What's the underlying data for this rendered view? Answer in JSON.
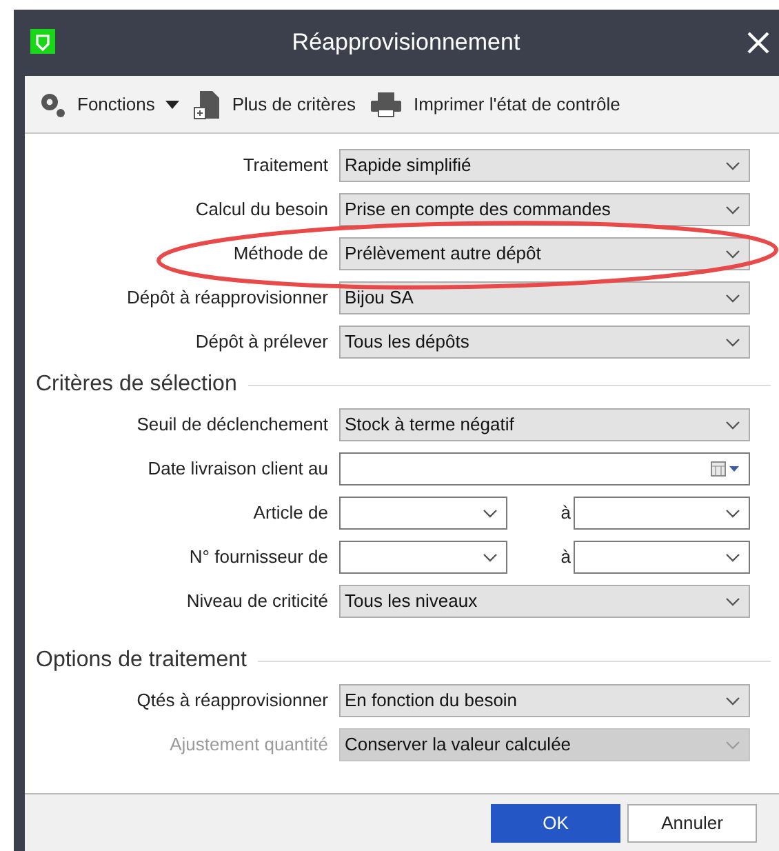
{
  "window": {
    "title": "Réapprovisionnement"
  },
  "toolbar": [
    {
      "label": "Fonctions",
      "kind": "menu"
    },
    {
      "label": "Plus de critères",
      "kind": "doc"
    },
    {
      "label": "Imprimer l'état de contrôle",
      "kind": "print"
    }
  ],
  "sections": [
    {
      "rows": [
        {
          "kind": "select",
          "label": "Traitement",
          "value": "Rapide simplifié",
          "disabled": false
        },
        {
          "kind": "select",
          "label": "Calcul du besoin",
          "value": "Prise en compte des commandes",
          "disabled": false
        },
        {
          "kind": "select",
          "label": "Méthode de",
          "value": "Prélèvement autre dépôt",
          "disabled": false
        },
        {
          "kind": "select",
          "label": "Dépôt à réapprovisionner",
          "value": "Bijou SA",
          "disabled": false
        },
        {
          "kind": "select",
          "label": "Dépôt à prélever",
          "value": "Tous les dépôts",
          "disabled": false
        }
      ]
    },
    {
      "title": "Critères de sélection",
      "rows": [
        {
          "kind": "select",
          "label": "Seuil de déclenchement",
          "value": "Stock à terme négatif",
          "disabled": false
        },
        {
          "kind": "date",
          "label": "Date livraison client au"
        },
        {
          "kind": "range",
          "label": "Article de",
          "to_label": "à"
        },
        {
          "kind": "range",
          "label": "N° fournisseur de",
          "to_label": "à"
        },
        {
          "kind": "select",
          "label": "Niveau de criticité",
          "value": "Tous les niveaux",
          "disabled": false
        }
      ]
    },
    {
      "title": "Options de traitement",
      "rows": [
        {
          "kind": "select",
          "label": "Qtés à réapprovisionner",
          "value": "En fonction du besoin",
          "disabled": false
        },
        {
          "kind": "select",
          "label": "Ajustement quantité",
          "value": "Conserver la valeur calculée",
          "disabled": true
        }
      ]
    }
  ],
  "buttons": [
    {
      "label": "OK",
      "kind": "primary"
    },
    {
      "label": "Annuler",
      "kind": "secondary"
    }
  ]
}
